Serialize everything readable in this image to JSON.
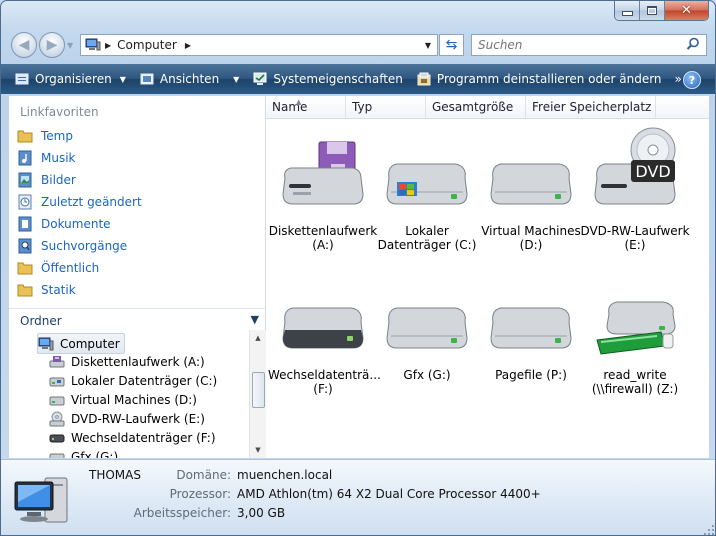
{
  "window": {
    "caption_buttons": [
      "minimize-icon",
      "maximize-icon",
      "close-icon"
    ]
  },
  "address": {
    "crumb": "Computer",
    "search_placeholder": "Suchen"
  },
  "toolbar": {
    "organize": "Organisieren",
    "views": "Ansichten",
    "system_properties": "Systemeigenschaften",
    "uninstall": "Programm deinstallieren oder ändern",
    "more": "»",
    "help": "?"
  },
  "sidebar": {
    "favorites_title": "Linkfavoriten",
    "favorites": [
      {
        "label": "Temp",
        "icon": "folder-icon"
      },
      {
        "label": "Musik",
        "icon": "music-icon"
      },
      {
        "label": "Bilder",
        "icon": "pictures-icon"
      },
      {
        "label": "Zuletzt geändert",
        "icon": "recent-icon"
      },
      {
        "label": "Dokumente",
        "icon": "documents-icon"
      },
      {
        "label": "Suchvorgänge",
        "icon": "searches-icon"
      },
      {
        "label": "Öffentlich",
        "icon": "folder-icon"
      },
      {
        "label": "Statik",
        "icon": "folder-icon"
      }
    ],
    "folders_title": "Ordner",
    "tree": [
      {
        "label": "Computer",
        "icon": "computer-icon",
        "selected": true
      },
      {
        "label": "Diskettenlaufwerk (A:)",
        "icon": "floppy-drive-icon"
      },
      {
        "label": "Lokaler Datenträger (C:)",
        "icon": "hard-drive-icon"
      },
      {
        "label": "Virtual Machines (D:)",
        "icon": "hard-drive-icon"
      },
      {
        "label": "DVD-RW-Laufwerk (E:)",
        "icon": "dvd-drive-icon"
      },
      {
        "label": "Wechseldatenträger (F:)",
        "icon": "removable-drive-icon"
      },
      {
        "label": "Gfx (G:)",
        "icon": "hard-drive-icon"
      }
    ]
  },
  "columns": [
    "Name",
    "Typ",
    "Gesamtgröße",
    "Freier Speicherplatz"
  ],
  "drives": [
    {
      "line1": "Diskettenlaufwerk",
      "line2": "(A:)",
      "icon": "floppy-drive-icon"
    },
    {
      "line1": "Lokaler",
      "line2": "Datenträger (C:)",
      "icon": "windows-drive-icon"
    },
    {
      "line1": "Virtual Machines",
      "line2": "(D:)",
      "icon": "hard-drive-icon"
    },
    {
      "line1": "DVD-RW-Laufwerk",
      "line2": "(E:)",
      "icon": "dvd-drive-icon",
      "badge": "DVD"
    },
    {
      "line1": "Wechseldatenträ...",
      "line2": "(F:)",
      "icon": "removable-drive-icon"
    },
    {
      "line1": "Gfx (G:)",
      "line2": "",
      "icon": "hard-drive-icon"
    },
    {
      "line1": "Pagefile (P:)",
      "line2": "",
      "icon": "hard-drive-icon"
    },
    {
      "line1": "read_write",
      "line2": "(\\\\firewall) (Z:)",
      "icon": "network-drive-icon"
    }
  ],
  "details": {
    "name": "THOMAS",
    "domain_label": "Domäne:",
    "domain_value": "muenchen.local",
    "cpu_label": "Prozessor:",
    "cpu_value": "AMD Athlon(tm) 64 X2 Dual Core Processor 4400+",
    "ram_label": "Arbeitsspeicher:",
    "ram_value": "3,00 GB"
  },
  "colors": {
    "toolbar": "#2e5680",
    "link": "#1c64c4",
    "details_label": "#5f6b78"
  }
}
